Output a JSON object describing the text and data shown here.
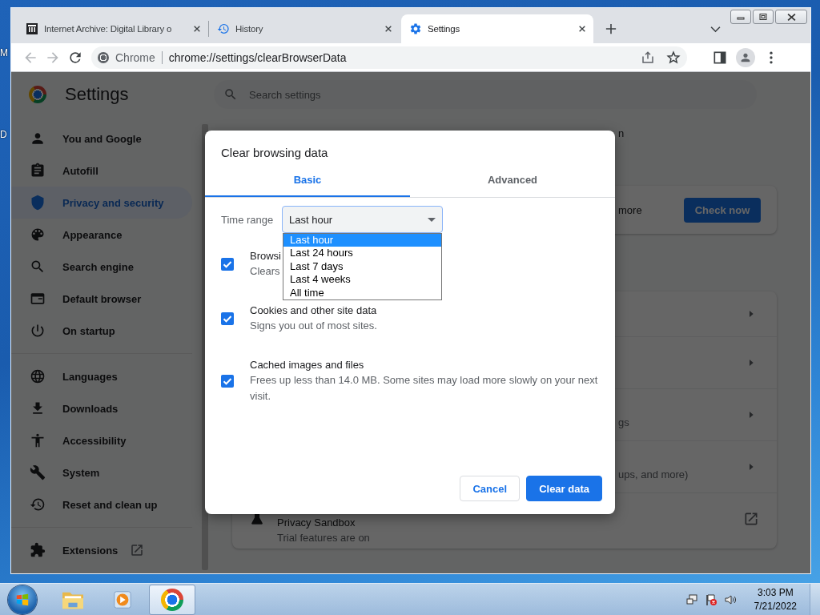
{
  "desktop": {
    "icon_labels": [
      "M",
      "D"
    ]
  },
  "browser": {
    "tabs": [
      {
        "title": "Internet Archive: Digital Library o",
        "selected": false
      },
      {
        "title": "History",
        "selected": false
      },
      {
        "title": "Settings",
        "selected": true
      }
    ],
    "omnibox": {
      "chip": "Chrome",
      "url": "chrome://settings/clearBrowserData"
    }
  },
  "settings": {
    "title": "Settings",
    "search_placeholder": "Search settings",
    "sidebar": {
      "sections": [
        [
          {
            "label": "You and Google",
            "selected": false,
            "external": false
          },
          {
            "label": "Autofill",
            "selected": false,
            "external": false
          },
          {
            "label": "Privacy and security",
            "selected": true,
            "external": false
          },
          {
            "label": "Appearance",
            "selected": false,
            "external": false
          },
          {
            "label": "Search engine",
            "selected": false,
            "external": false
          },
          {
            "label": "Default browser",
            "selected": false,
            "external": false
          },
          {
            "label": "On startup",
            "selected": false,
            "external": false
          }
        ],
        [
          {
            "label": "Languages",
            "selected": false,
            "external": false
          },
          {
            "label": "Downloads",
            "selected": false,
            "external": false
          },
          {
            "label": "Accessibility",
            "selected": false,
            "external": false
          },
          {
            "label": "System",
            "selected": false,
            "external": false
          },
          {
            "label": "Reset and clean up",
            "selected": false,
            "external": false
          }
        ],
        [
          {
            "label": "Extensions",
            "selected": false,
            "external": true
          }
        ]
      ]
    },
    "main": {
      "heading_fragment": "n",
      "safety_card": {
        "text": "more",
        "button": "Check now"
      },
      "rows": [
        {
          "kind": "arrow"
        },
        {
          "kind": "arrow"
        },
        {
          "kind": "arrow",
          "subtitle": "gs"
        },
        {
          "kind": "arrow",
          "subtitle": "ups, and more)"
        },
        {
          "kind": "external",
          "title": "Privacy Sandbox",
          "subtitle": "Trial features are on"
        }
      ]
    }
  },
  "dialog": {
    "title": "Clear browsing data",
    "tabs": [
      {
        "label": "Basic",
        "selected": true
      },
      {
        "label": "Advanced",
        "selected": false
      }
    ],
    "time_range": {
      "label": "Time range",
      "value": "Last hour",
      "expanded": true,
      "options": [
        {
          "label": "Last hour",
          "selected": true
        },
        {
          "label": "Last 24 hours",
          "selected": false
        },
        {
          "label": "Last 7 days",
          "selected": false
        },
        {
          "label": "Last 4 weeks",
          "selected": false
        },
        {
          "label": "All time",
          "selected": false
        }
      ]
    },
    "options": [
      {
        "title": "Browsi",
        "description": "Clears",
        "checked": true
      },
      {
        "title": "Cookies and other site data",
        "description": "Signs you out of most sites.",
        "checked": true
      },
      {
        "title": "Cached images and files",
        "description": "Frees up less than 14.0 MB. Some sites may load more slowly on your next visit.",
        "checked": true
      }
    ],
    "buttons": [
      {
        "label": "Cancel",
        "kind": "secondary"
      },
      {
        "label": "Clear data",
        "kind": "primary"
      }
    ]
  },
  "taskbar": {
    "apps": [
      {
        "selected": false
      },
      {
        "selected": false
      },
      {
        "selected": true
      }
    ],
    "clock": {
      "time": "3:03 PM",
      "date": "7/21/2022"
    }
  }
}
